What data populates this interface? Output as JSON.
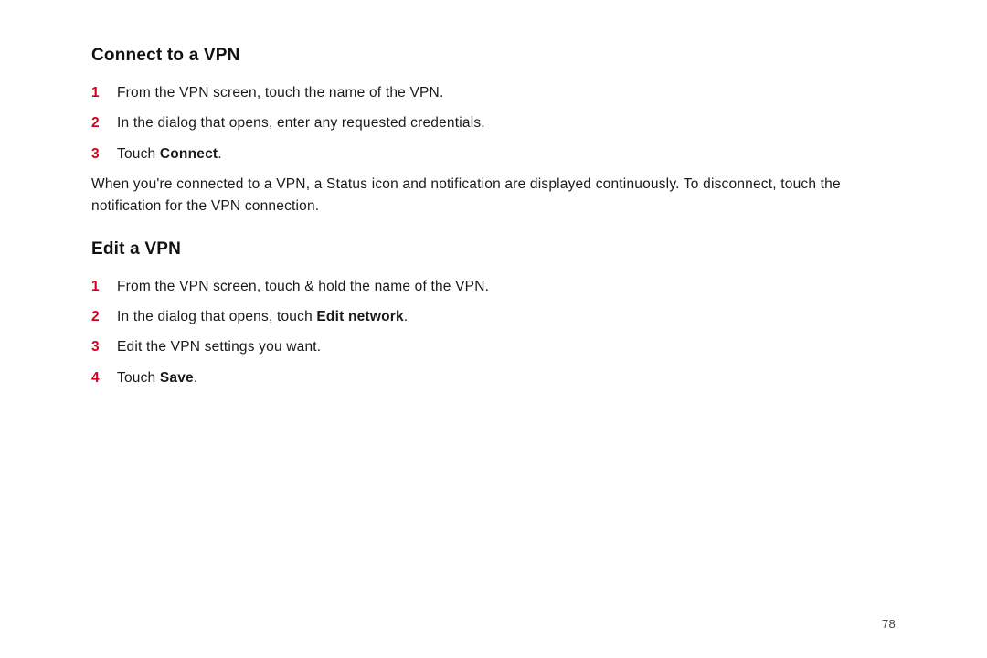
{
  "section1": {
    "heading": "Connect to a VPN",
    "steps": [
      {
        "num": "1",
        "text": "From the VPN screen, touch the name of the VPN."
      },
      {
        "num": "2",
        "text": "In the dialog that opens, enter any requested credentials."
      },
      {
        "num": "3",
        "prefix": "Touch ",
        "bold": "Connect",
        "suffix": "."
      }
    ],
    "para": "When you're connected to a VPN, a Status icon and notification are displayed continuously. To disconnect, touch the notification for the VPN connection."
  },
  "section2": {
    "heading": "Edit a VPN",
    "steps": [
      {
        "num": "1",
        "text": "From the VPN screen, touch & hold the name of the VPN."
      },
      {
        "num": "2",
        "prefix": "In the dialog that opens, touch ",
        "bold": "Edit network",
        "suffix": "."
      },
      {
        "num": "3",
        "text": "Edit the VPN settings you want."
      },
      {
        "num": "4",
        "prefix": "Touch ",
        "bold": "Save",
        "suffix": "."
      }
    ]
  },
  "page_number": "78"
}
